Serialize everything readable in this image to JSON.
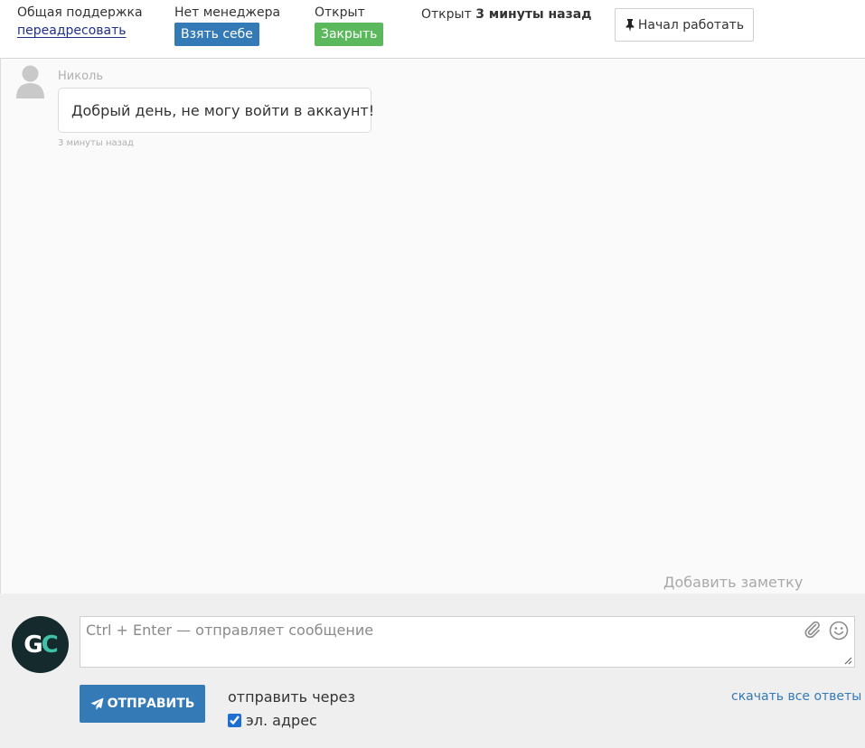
{
  "header": {
    "department": "Общая поддержка",
    "redirect_link": "переадресовать",
    "manager_status": "Нет менеджера",
    "take_button": "Взять себе",
    "ticket_status": "Открыт",
    "close_button": "Закрыть",
    "opened_label": "Открыт",
    "opened_ago": "3 минуты назад",
    "start_work_button": "Начал работать"
  },
  "conversation": {
    "messages": [
      {
        "author": "Николь",
        "text": "Добрый день, не могу войти в аккаунт!",
        "time": "3 минуты назад"
      }
    ],
    "add_note": "Добавить заметку"
  },
  "composer": {
    "logo_letters": [
      "G",
      "C"
    ],
    "input_placeholder": "Ctrl + Enter — отправляет сообщение",
    "input_value": "",
    "send_button": "ОТПРАВИТЬ",
    "send_via_label": "отправить через",
    "channel_email": "эл. адрес",
    "channel_email_checked": true,
    "download_all": "скачать все ответы"
  },
  "colors": {
    "primary_blue": "#337ab7",
    "success_green": "#5cb85c",
    "logo_bg": "#142a2c",
    "logo_accent": "#3fc0a8"
  },
  "icons": [
    "pin-icon",
    "user-avatar-icon",
    "paperclip-icon",
    "smile-icon",
    "send-plane-icon",
    "resize-handle-icon"
  ]
}
